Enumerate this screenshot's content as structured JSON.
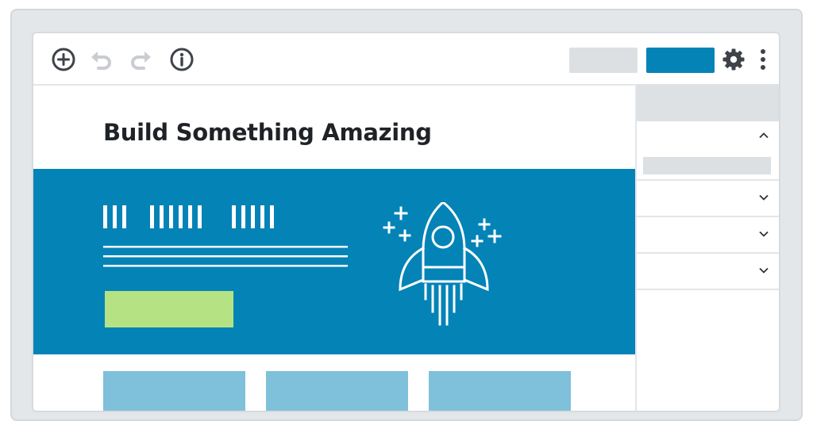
{
  "page": {
    "title": "Build Something Amazing"
  },
  "toolbar": {
    "icons": [
      "add-circle-icon",
      "undo-icon",
      "redo-icon",
      "info-icon",
      "gear-icon",
      "more-vertical-icon"
    ],
    "secondary_button_label": "",
    "primary_button_label": ""
  },
  "hero": {
    "cta_label": "",
    "illustration": "rocket-icon"
  },
  "side_panel": {
    "header_label": "",
    "sections": [
      {
        "label": "",
        "state": "expanded",
        "icon": "chevron-up-icon"
      },
      {
        "label": "",
        "state": "collapsed",
        "icon": "chevron-down-icon"
      },
      {
        "label": "",
        "state": "collapsed",
        "icon": "chevron-down-icon"
      },
      {
        "label": "",
        "state": "collapsed",
        "icon": "chevron-down-icon"
      }
    ]
  },
  "colors": {
    "frame": "#e4e7ea",
    "accent": "#0483b7",
    "cta": "#b5e384",
    "card": "#7fc0db",
    "panel_header": "#dee1e4",
    "icon_dark": "#3e4349",
    "icon_disabled": "#c9cdd1"
  }
}
